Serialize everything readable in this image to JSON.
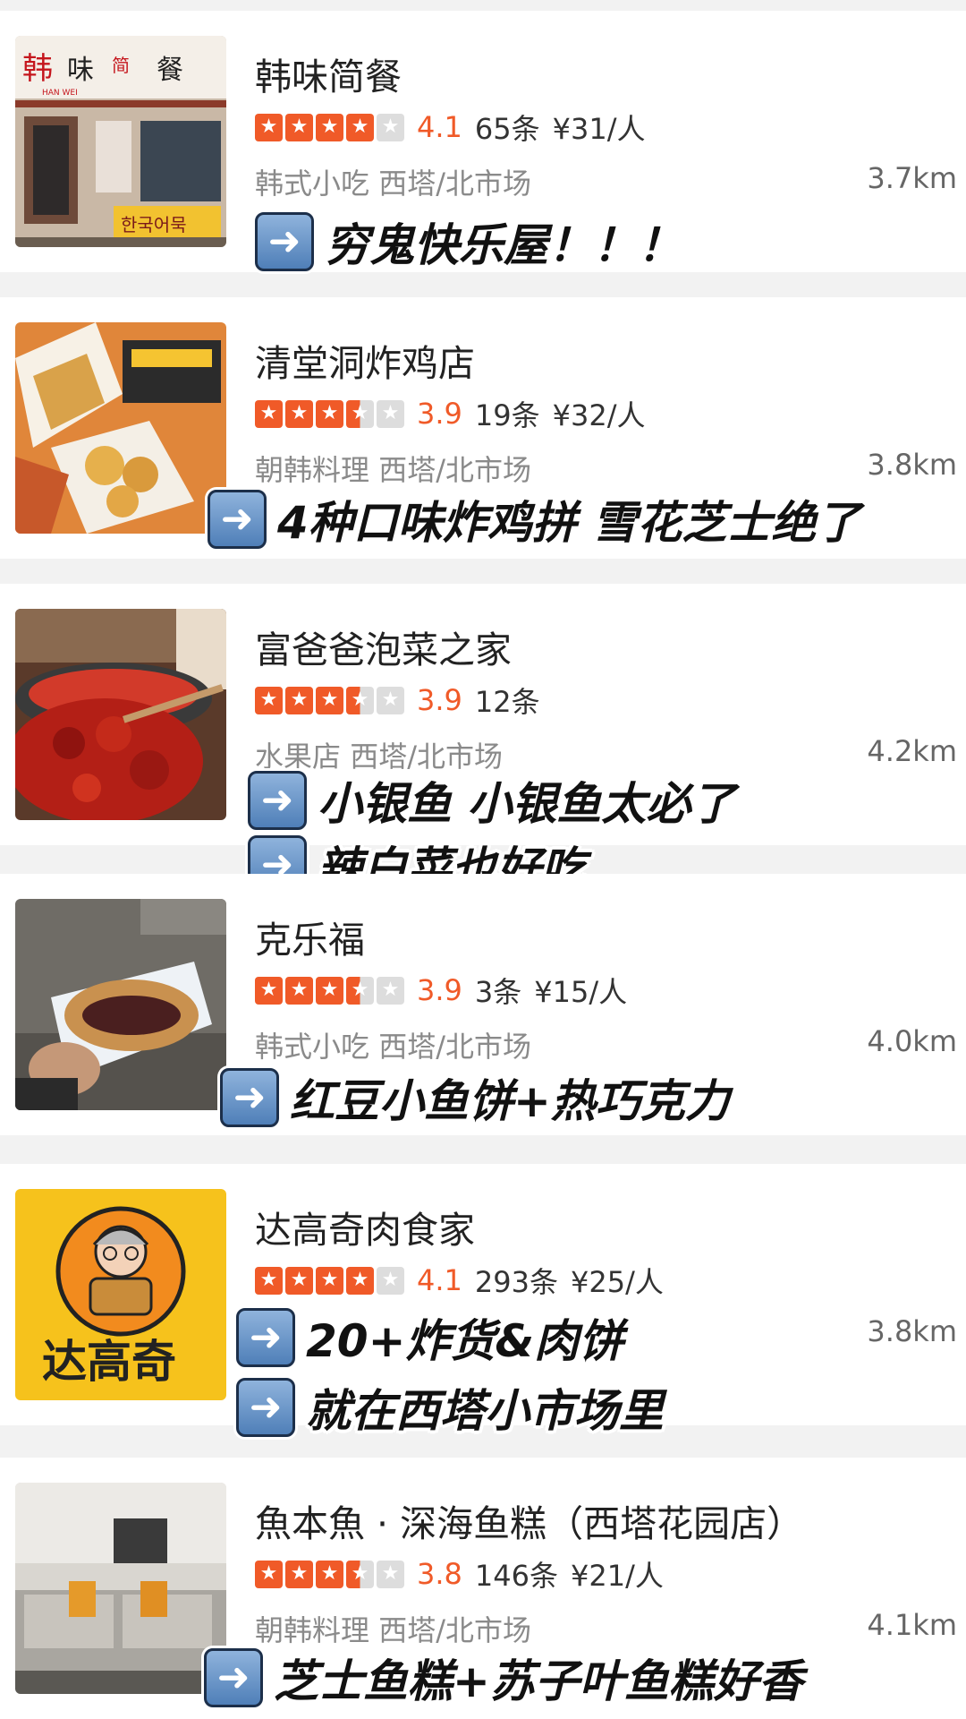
{
  "restaurants": [
    {
      "name": "韩味简餐",
      "stars": [
        "full",
        "full",
        "full",
        "full",
        "empty"
      ],
      "score": "4.1",
      "reviews": "65条",
      "price": "¥31/人",
      "category": "韩式小吃",
      "area": "西塔/北市场",
      "distance": "3.7km",
      "notes": [
        "穷鬼快乐屋！！！"
      ]
    },
    {
      "name": "清堂洞炸鸡店",
      "stars": [
        "full",
        "full",
        "full",
        "half",
        "empty"
      ],
      "score": "3.9",
      "reviews": "19条",
      "price": "¥32/人",
      "category": "朝韩料理",
      "area": "西塔/北市场",
      "distance": "3.8km",
      "notes": [
        "4种口味炸鸡拼 雪花芝士绝了"
      ]
    },
    {
      "name": "富爸爸泡菜之家",
      "stars": [
        "full",
        "full",
        "full",
        "half",
        "empty"
      ],
      "score": "3.9",
      "reviews": "12条",
      "price": "",
      "category": "水果店",
      "area": "西塔/北市场",
      "distance": "4.2km",
      "notes": [
        "小银鱼 小银鱼太必了",
        "辣白菜也好吃"
      ]
    },
    {
      "name": "克乐福",
      "stars": [
        "full",
        "full",
        "full",
        "half",
        "empty"
      ],
      "score": "3.9",
      "reviews": "3条",
      "price": "¥15/人",
      "category": "韩式小吃",
      "area": "西塔/北市场",
      "distance": "4.0km",
      "notes": [
        "红豆小鱼饼+热巧克力"
      ]
    },
    {
      "name": "达高奇肉食家",
      "stars": [
        "full",
        "full",
        "full",
        "full",
        "empty"
      ],
      "score": "4.1",
      "reviews": "293条",
      "price": "¥25/人",
      "category": "",
      "area": "",
      "distance": "3.8km",
      "logo_text": "达高奇",
      "notes": [
        "20+炸货&肉饼",
        "就在西塔小市场里"
      ]
    },
    {
      "name": "魚本魚 · 深海鱼糕（西塔花园店）",
      "stars": [
        "full",
        "full",
        "full",
        "half",
        "empty"
      ],
      "score": "3.8",
      "reviews": "146条",
      "price": "¥21/人",
      "category": "朝韩料理",
      "area": "西塔/北市场",
      "distance": "4.1km",
      "notes": [
        "芝士鱼糕+苏子叶鱼糕好香"
      ]
    }
  ],
  "thumb_signs": {
    "r0": "韩 味 简 餐",
    "r0_sub": "HAN WEI",
    "r0_korean": "한국어묵"
  },
  "colors": {
    "accent": "#f05a28",
    "star_empty": "#dddddd",
    "background": "#f2f2f2"
  },
  "icons": {
    "arrow": "right-arrow-emoji-icon",
    "star": "star-icon"
  }
}
